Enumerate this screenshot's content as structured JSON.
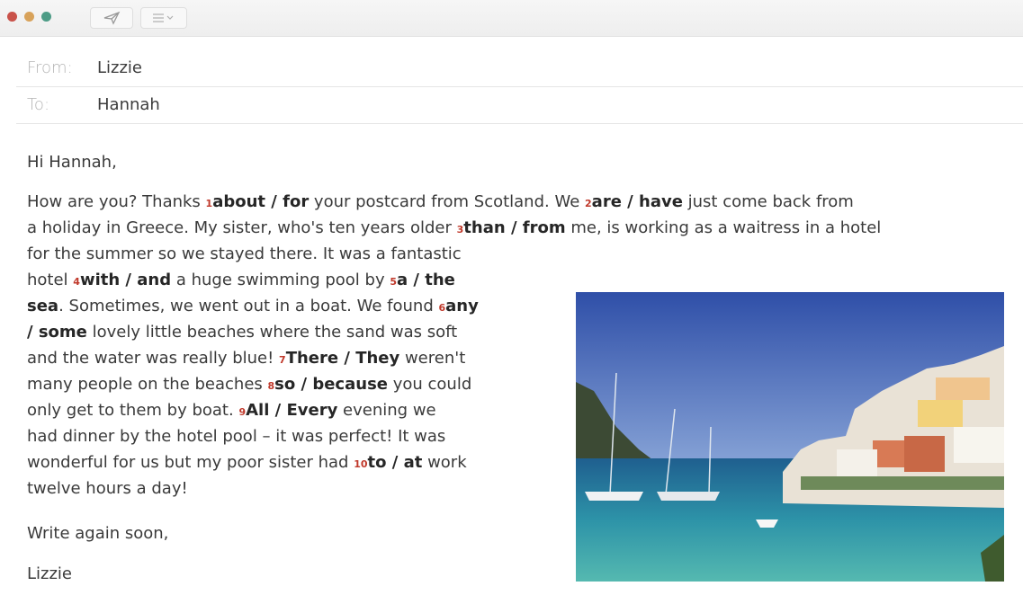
{
  "email": {
    "from_label": "From:",
    "from_value": "Lizzie",
    "to_label": "To:",
    "to_value": "Hannah",
    "greeting": "Hi Hannah,",
    "lines": [
      {
        "parts": [
          {
            "t": "How are you? Thanks "
          },
          {
            "n": "1"
          },
          {
            "b": "about / for"
          },
          {
            "t": " your postcard from Scotland. We "
          },
          {
            "n": "2"
          },
          {
            "b": "are / have"
          },
          {
            "t": " just come back from"
          }
        ]
      },
      {
        "parts": [
          {
            "t": "a holiday in Greece. My sister, who's ten years older "
          },
          {
            "n": "3"
          },
          {
            "b": "than / from"
          },
          {
            "t": " me, is working as a waitress in a hotel"
          }
        ]
      },
      {
        "parts": [
          {
            "t": "for the summer so we stayed there. It was a fantastic"
          }
        ]
      },
      {
        "parts": [
          {
            "t": "hotel "
          },
          {
            "n": "4"
          },
          {
            "b": "with / and"
          },
          {
            "t": " a huge swimming pool by "
          },
          {
            "n": "5"
          },
          {
            "b": "a / the"
          }
        ]
      },
      {
        "parts": [
          {
            "b": "sea"
          },
          {
            "t": ". Sometimes, we went out in a boat. We found "
          },
          {
            "n": "6"
          },
          {
            "b": "any"
          }
        ]
      },
      {
        "parts": [
          {
            "b": "/ some"
          },
          {
            "t": " lovely little beaches where the sand was soft"
          }
        ]
      },
      {
        "parts": [
          {
            "t": "and the water was really blue! "
          },
          {
            "n": "7"
          },
          {
            "b": "There / They"
          },
          {
            "t": " weren't"
          }
        ]
      },
      {
        "parts": [
          {
            "t": "many people on the beaches "
          },
          {
            "n": "8"
          },
          {
            "b": "so / because"
          },
          {
            "t": " you could"
          }
        ]
      },
      {
        "parts": [
          {
            "t": "only get to them by boat. "
          },
          {
            "n": "9"
          },
          {
            "b": "All / Every"
          },
          {
            "t": " evening we"
          }
        ]
      },
      {
        "parts": [
          {
            "t": "had dinner by the hotel pool – it was perfect! It was"
          }
        ]
      },
      {
        "parts": [
          {
            "t": "wonderful for us but my poor sister had "
          },
          {
            "n": "10"
          },
          {
            "b": "to / at"
          },
          {
            "t": " work"
          }
        ]
      },
      {
        "parts": [
          {
            "t": "twelve hours a day!"
          }
        ]
      }
    ],
    "signoff": "Write again soon,",
    "signature": "Lizzie"
  },
  "toolbar": {
    "send_icon": "paper-plane-icon",
    "format_icon": "list-format-icon"
  },
  "colors": {
    "traffic_red": "#c9524a",
    "traffic_yellow": "#d8a25a",
    "traffic_green": "#4d9c86",
    "gap_number": "#c0392b"
  }
}
